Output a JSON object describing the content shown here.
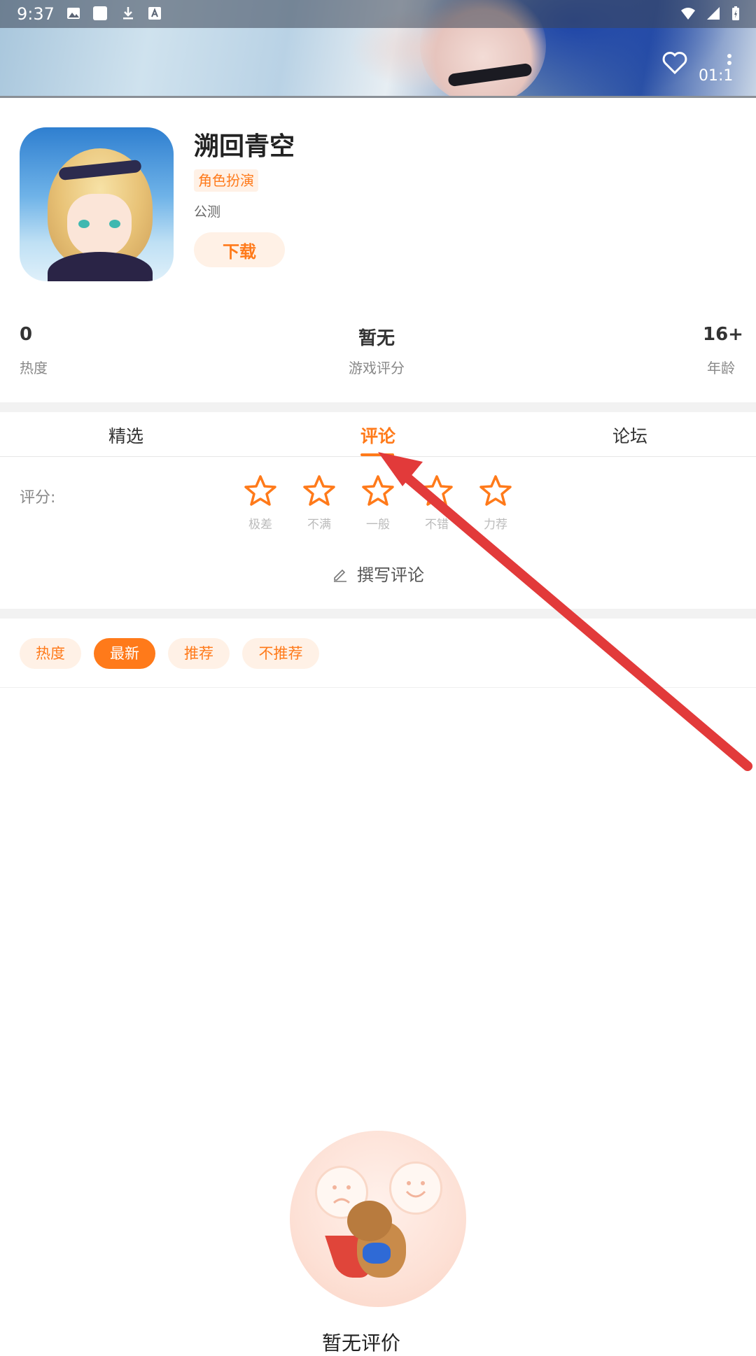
{
  "status_bar": {
    "time": "9:37"
  },
  "banner": {
    "video_time": "01:1"
  },
  "game": {
    "title": "溯回青空",
    "genre": "角色扮演",
    "test_status": "公测",
    "download_label": "下载"
  },
  "stats": [
    {
      "value": "0",
      "label": "热度"
    },
    {
      "value": "暂无",
      "label": "游戏评分"
    },
    {
      "value": "16+",
      "label": "年龄"
    }
  ],
  "tabs": [
    {
      "label": "精选",
      "active": false
    },
    {
      "label": "评论",
      "active": true
    },
    {
      "label": "论坛",
      "active": false
    }
  ],
  "rating": {
    "label": "评分:",
    "stars": [
      "极差",
      "不满",
      "一般",
      "不错",
      "力荐"
    ],
    "write_review": "撰写评论"
  },
  "filters": [
    {
      "label": "热度",
      "active": false
    },
    {
      "label": "最新",
      "active": true
    },
    {
      "label": "推荐",
      "active": false
    },
    {
      "label": "不推荐",
      "active": false
    }
  ],
  "empty_state": {
    "text": "暂无评价"
  },
  "colors": {
    "accent": "#ff7a1a",
    "accent_light": "#fff1e6",
    "annotation_arrow": "#e23a3a"
  },
  "icons": [
    "image-icon",
    "square-icon",
    "download-icon",
    "font-icon",
    "wifi-icon",
    "signal-icon",
    "battery-icon",
    "heart-icon",
    "more-icon",
    "star-icon",
    "pen-icon"
  ]
}
